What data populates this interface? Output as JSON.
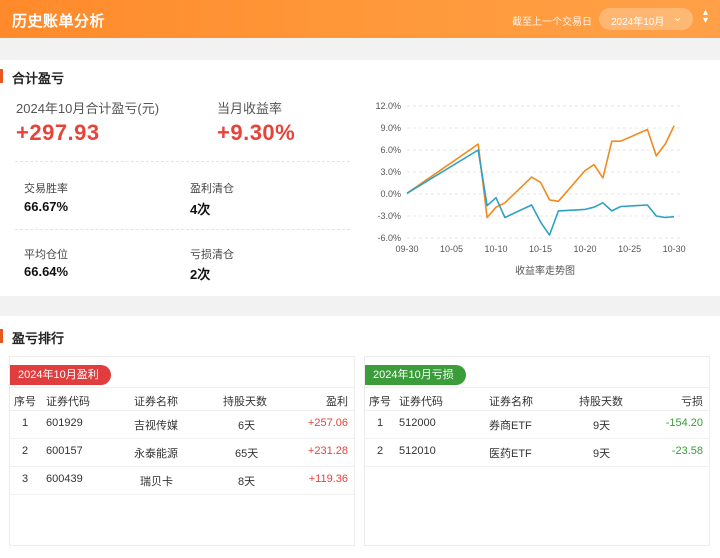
{
  "header": {
    "title": "历史账单分析",
    "hint": "截至上一个交易日",
    "month_selected": "2024年10月"
  },
  "summary": {
    "section_title": "合计盈亏",
    "total_label": "2024年10月合计盈亏(元)",
    "total_value": "+297.93",
    "return_label": "当月收益率",
    "return_value": "+9.30%",
    "win_rate_label": "交易胜率",
    "win_rate_value": "66.67%",
    "profit_clear_label": "盈利清仓",
    "profit_clear_value": "4次",
    "avg_pos_label": "平均仓位",
    "avg_pos_value": "66.64%",
    "loss_clear_label": "亏损清仓",
    "loss_clear_value": "2次"
  },
  "chart_data": {
    "type": "line",
    "title": "收益率走势图",
    "x_ticks": [
      "09-30",
      "10-05",
      "10-10",
      "10-15",
      "10-20",
      "10-25",
      "10-30"
    ],
    "y_ticks": [
      "12.0%",
      "9.0%",
      "6.0%",
      "3.0%",
      "0.0%",
      "-3.0%",
      "-6.0%"
    ],
    "ylim": [
      -6.0,
      12.0
    ],
    "xlim": [
      0,
      31
    ],
    "grid": "horizontal dashed",
    "series": [
      {
        "color": "#f28a1d",
        "x": [
          0,
          8,
          9,
          10,
          11,
          14,
          15,
          16,
          17,
          20,
          21,
          22,
          23,
          24,
          27,
          28,
          29,
          30
        ],
        "values": [
          0.1,
          6.8,
          -3.2,
          -1.8,
          -1.2,
          2.3,
          1.6,
          -0.8,
          -1.0,
          3.2,
          4.0,
          2.2,
          7.2,
          7.2,
          8.8,
          5.2,
          6.8,
          9.3
        ]
      },
      {
        "color": "#2ea0c6",
        "x": [
          0,
          8,
          9,
          10,
          11,
          14,
          15,
          16,
          17,
          20,
          21,
          22,
          23,
          24,
          27,
          28,
          29,
          30
        ],
        "values": [
          0.1,
          6.0,
          -1.6,
          -0.5,
          -3.2,
          -1.5,
          -3.8,
          -5.6,
          -2.3,
          -2.1,
          -1.8,
          -1.2,
          -2.3,
          -1.7,
          -1.5,
          -3.0,
          -3.2,
          -3.1
        ]
      }
    ]
  },
  "ranking": {
    "section_title": "盈亏排行",
    "profit": {
      "badge": "2024年10月盈利",
      "headers": [
        "序号",
        "证券代码",
        "证券名称",
        "持股天数",
        "盈利"
      ],
      "rows": [
        [
          "1",
          "601929",
          "吉视传媒",
          "6天",
          "+257.06"
        ],
        [
          "2",
          "600157",
          "永泰能源",
          "65天",
          "+231.28"
        ],
        [
          "3",
          "600439",
          "瑞贝卡",
          "8天",
          "+119.36"
        ]
      ]
    },
    "loss": {
      "badge": "2024年10月亏损",
      "headers": [
        "序号",
        "证券代码",
        "证券名称",
        "持股天数",
        "亏损"
      ],
      "rows": [
        [
          "1",
          "512000",
          "券商ETF",
          "9天",
          "-154.20"
        ],
        [
          "2",
          "512010",
          "医药ETF",
          "9天",
          "-23.58"
        ]
      ]
    }
  }
}
